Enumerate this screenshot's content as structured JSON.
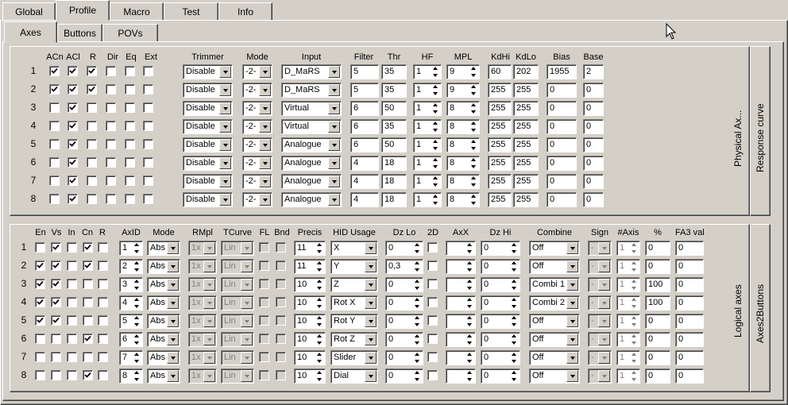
{
  "main_tabs": [
    "Global",
    "Profile",
    "Macro",
    "Test",
    "Info"
  ],
  "sub_tabs": [
    "Axes",
    "Buttons",
    "POVs"
  ],
  "physical": {
    "side_labels": [
      "Physical Ax...",
      "Response curve"
    ],
    "headers": {
      "acn": "ACn",
      "acl": "ACl",
      "r": "R",
      "dir": "Dir",
      "eq": "Eq",
      "ext": "Ext",
      "trimmer": "Trimmer",
      "mode": "Mode",
      "input": "Input",
      "filter": "Filter",
      "thr": "Thr",
      "hf": "HF",
      "mpl": "MPL",
      "kdhi": "KdHi",
      "kdlo": "KdLo",
      "bias": "Bias",
      "base": "Base"
    },
    "rows": [
      {
        "num": "1",
        "acn": true,
        "acl": true,
        "r": true,
        "dir": false,
        "eq": false,
        "ext": false,
        "trimmer": "Disable",
        "mode": "-2-",
        "input": "D_MaRS",
        "filter": "5",
        "thr": "35",
        "hf": "1",
        "mpl": "9",
        "kdhi": "60",
        "kdlo": "202",
        "bias": "1955",
        "base": "2"
      },
      {
        "num": "2",
        "acn": true,
        "acl": true,
        "r": true,
        "dir": false,
        "eq": false,
        "ext": false,
        "trimmer": "Disable",
        "mode": "-2-",
        "input": "D_MaRS",
        "filter": "5",
        "thr": "35",
        "hf": "1",
        "mpl": "9",
        "kdhi": "255",
        "kdlo": "255",
        "bias": "0",
        "base": "0"
      },
      {
        "num": "3",
        "acn": false,
        "acl": true,
        "r": false,
        "dir": false,
        "eq": false,
        "ext": false,
        "trimmer": "Disable",
        "mode": "-2-",
        "input": "Virtual",
        "filter": "6",
        "thr": "50",
        "hf": "1",
        "mpl": "8",
        "kdhi": "255",
        "kdlo": "255",
        "bias": "0",
        "base": "0"
      },
      {
        "num": "4",
        "acn": false,
        "acl": true,
        "r": false,
        "dir": false,
        "eq": false,
        "ext": false,
        "trimmer": "Disable",
        "mode": "-2-",
        "input": "Virtual",
        "filter": "6",
        "thr": "35",
        "hf": "1",
        "mpl": "8",
        "kdhi": "255",
        "kdlo": "255",
        "bias": "0",
        "base": "0"
      },
      {
        "num": "5",
        "acn": false,
        "acl": true,
        "r": false,
        "dir": false,
        "eq": false,
        "ext": false,
        "trimmer": "Disable",
        "mode": "-2-",
        "input": "Analogue",
        "filter": "6",
        "thr": "50",
        "hf": "1",
        "mpl": "8",
        "kdhi": "255",
        "kdlo": "255",
        "bias": "0",
        "base": "0"
      },
      {
        "num": "6",
        "acn": false,
        "acl": true,
        "r": false,
        "dir": false,
        "eq": false,
        "ext": false,
        "trimmer": "Disable",
        "mode": "-2-",
        "input": "Analogue",
        "filter": "4",
        "thr": "18",
        "hf": "1",
        "mpl": "8",
        "kdhi": "255",
        "kdlo": "255",
        "bias": "0",
        "base": "0"
      },
      {
        "num": "7",
        "acn": false,
        "acl": true,
        "r": false,
        "dir": false,
        "eq": false,
        "ext": false,
        "trimmer": "Disable",
        "mode": "-2-",
        "input": "Analogue",
        "filter": "4",
        "thr": "18",
        "hf": "1",
        "mpl": "8",
        "kdhi": "255",
        "kdlo": "255",
        "bias": "0",
        "base": "0"
      },
      {
        "num": "8",
        "acn": false,
        "acl": true,
        "r": false,
        "dir": false,
        "eq": false,
        "ext": false,
        "trimmer": "Disable",
        "mode": "-2-",
        "input": "Analogue",
        "filter": "4",
        "thr": "18",
        "hf": "1",
        "mpl": "8",
        "kdhi": "255",
        "kdlo": "255",
        "bias": "0",
        "base": "0"
      }
    ]
  },
  "logical": {
    "side_labels": [
      "Logical axes",
      "Axes2Buttons"
    ],
    "headers": {
      "en": "En",
      "vs": "Vs",
      "in": "In",
      "cn": "Cn",
      "r": "R",
      "axid": "AxID",
      "mode": "Mode",
      "rmpl": "RMpl",
      "tcurve": "TCurve",
      "fl": "FL",
      "bnd": "Bnd",
      "precis": "Precis",
      "hid": "HID Usage",
      "dzlo": "Dz Lo",
      "twod": "2D",
      "axx": "AxX",
      "dzhi": "Dz Hi",
      "combine": "Combine",
      "sign": "Sign",
      "naxis": "#Axis",
      "pct": "%",
      "fa3": "FA3 val"
    },
    "rows": [
      {
        "num": "1",
        "en": false,
        "vs": true,
        "in": false,
        "cn": true,
        "r": false,
        "axid": "1",
        "mode": "Abs",
        "rmpl": "1x",
        "tcurve": "Lin",
        "precis": "11",
        "hid": "X",
        "dzlo": "0",
        "axx": "",
        "dzhi": "0",
        "combine": "Off",
        "sign": "-",
        "naxis": "1",
        "pct": "0",
        "fa3": "0"
      },
      {
        "num": "2",
        "en": true,
        "vs": true,
        "in": false,
        "cn": true,
        "r": false,
        "axid": "2",
        "mode": "Abs",
        "rmpl": "1x",
        "tcurve": "Lin",
        "precis": "11",
        "hid": "Y",
        "dzlo": "0,3",
        "axx": "",
        "dzhi": "0",
        "combine": "Off",
        "sign": "-",
        "naxis": "1",
        "pct": "0",
        "fa3": "0"
      },
      {
        "num": "3",
        "en": true,
        "vs": true,
        "in": false,
        "cn": false,
        "r": false,
        "axid": "3",
        "mode": "Abs",
        "rmpl": "1x",
        "tcurve": "Lin",
        "precis": "10",
        "hid": "Z",
        "dzlo": "0",
        "axx": "",
        "dzhi": "0",
        "combine": "Combi 1",
        "sign": "-",
        "naxis": "1",
        "pct": "100",
        "fa3": "0"
      },
      {
        "num": "4",
        "en": true,
        "vs": true,
        "in": false,
        "cn": false,
        "r": false,
        "axid": "4",
        "mode": "Abs",
        "rmpl": "1x",
        "tcurve": "Lin",
        "precis": "10",
        "hid": "Rot X",
        "dzlo": "0",
        "axx": "",
        "dzhi": "0",
        "combine": "Combi 2",
        "sign": "-",
        "naxis": "1",
        "pct": "100",
        "fa3": "0"
      },
      {
        "num": "5",
        "en": true,
        "vs": true,
        "in": false,
        "cn": false,
        "r": false,
        "axid": "5",
        "mode": "Abs",
        "rmpl": "1x",
        "tcurve": "Lin",
        "precis": "10",
        "hid": "Rot Y",
        "dzlo": "0",
        "axx": "",
        "dzhi": "0",
        "combine": "Off",
        "sign": "-",
        "naxis": "1",
        "pct": "0",
        "fa3": "0"
      },
      {
        "num": "6",
        "en": false,
        "vs": false,
        "in": false,
        "cn": true,
        "r": false,
        "axid": "6",
        "mode": "Abs",
        "rmpl": "1x",
        "tcurve": "Lin",
        "precis": "10",
        "hid": "Rot Z",
        "dzlo": "0",
        "axx": "",
        "dzhi": "0",
        "combine": "Off",
        "sign": "-",
        "naxis": "1",
        "pct": "0",
        "fa3": "0"
      },
      {
        "num": "7",
        "en": false,
        "vs": false,
        "in": false,
        "cn": false,
        "r": false,
        "axid": "7",
        "mode": "Abs",
        "rmpl": "1x",
        "tcurve": "Lin",
        "precis": "10",
        "hid": "Slider",
        "dzlo": "0",
        "axx": "",
        "dzhi": "0",
        "combine": "Off",
        "sign": "-",
        "naxis": "1",
        "pct": "0",
        "fa3": "0"
      },
      {
        "num": "8",
        "en": false,
        "vs": false,
        "in": false,
        "cn": true,
        "r": false,
        "axid": "8",
        "mode": "Abs",
        "rmpl": "1x",
        "tcurve": "Lin",
        "precis": "10",
        "hid": "Dial",
        "dzlo": "0",
        "axx": "",
        "dzhi": "0",
        "combine": "Off",
        "sign": "-",
        "naxis": "1",
        "pct": "0",
        "fa3": "0"
      }
    ]
  }
}
